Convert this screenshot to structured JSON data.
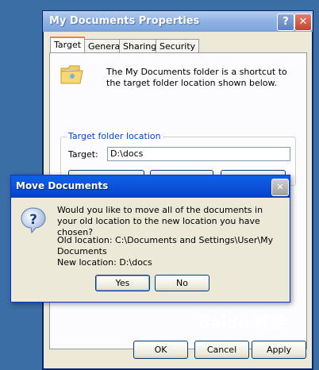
{
  "props": {
    "title": "My Documents Properties",
    "help_btn": "?",
    "close_btn": "✕",
    "tabs": [
      {
        "label": "Target"
      },
      {
        "label": "General"
      },
      {
        "label": "Sharing"
      },
      {
        "label": "Security"
      }
    ],
    "description": "The My Documents folder is a shortcut to the target folder location shown below.",
    "group_label": "Target folder location",
    "target_label": "Target:",
    "target_value": "D:\\docs",
    "buttons": {
      "ok": "OK",
      "cancel": "Cancel",
      "apply": "Apply"
    }
  },
  "move": {
    "title": "Move Documents",
    "close_btn": "✕",
    "message": "Would you like to move all of the documents in your old location to the new location you have chosen?",
    "old_location": "Old location: C:\\Documents and Settings\\User\\My Documents",
    "new_location": "New location: D:\\docs",
    "yes": "Yes",
    "no": "No"
  },
  "watermark": "Baidu 经验"
}
